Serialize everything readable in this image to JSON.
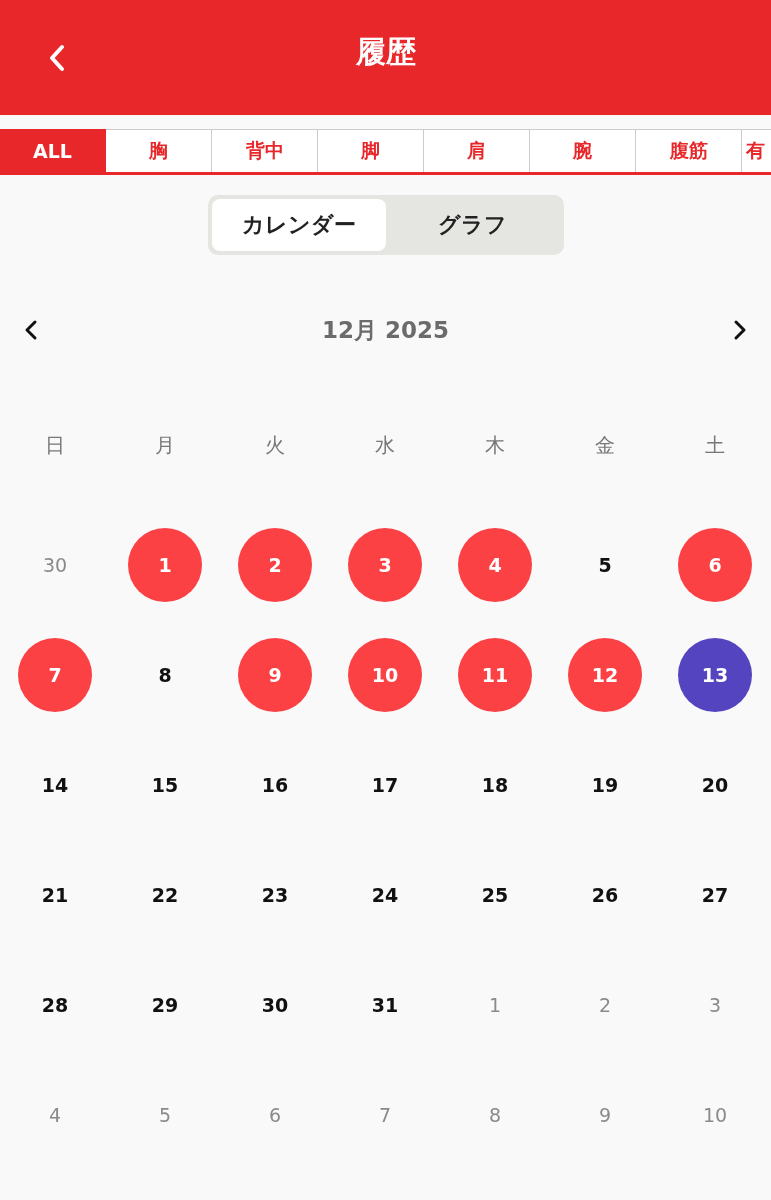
{
  "header": {
    "title": "履歴"
  },
  "tabs": [
    {
      "label": "ALL",
      "selected": true
    },
    {
      "label": "胸",
      "selected": false
    },
    {
      "label": "背中",
      "selected": false
    },
    {
      "label": "脚",
      "selected": false
    },
    {
      "label": "肩",
      "selected": false
    },
    {
      "label": "腕",
      "selected": false
    },
    {
      "label": "腹筋",
      "selected": false
    },
    {
      "label": "有",
      "selected": false
    }
  ],
  "view_switch": [
    {
      "label": "カレンダー",
      "selected": true
    },
    {
      "label": "グラフ",
      "selected": false
    }
  ],
  "calendar": {
    "month": "12月 2025",
    "weekdays": [
      "日",
      "月",
      "火",
      "水",
      "木",
      "金",
      "土"
    ],
    "days": [
      {
        "label": "30",
        "kind": "other"
      },
      {
        "label": "1",
        "kind": "trained"
      },
      {
        "label": "2",
        "kind": "trained"
      },
      {
        "label": "3",
        "kind": "trained"
      },
      {
        "label": "4",
        "kind": "trained"
      },
      {
        "label": "5",
        "kind": "normal"
      },
      {
        "label": "6",
        "kind": "trained"
      },
      {
        "label": "7",
        "kind": "trained"
      },
      {
        "label": "8",
        "kind": "normal"
      },
      {
        "label": "9",
        "kind": "trained"
      },
      {
        "label": "10",
        "kind": "trained"
      },
      {
        "label": "11",
        "kind": "trained"
      },
      {
        "label": "12",
        "kind": "trained"
      },
      {
        "label": "13",
        "kind": "today"
      },
      {
        "label": "14",
        "kind": "normal"
      },
      {
        "label": "15",
        "kind": "normal"
      },
      {
        "label": "16",
        "kind": "normal"
      },
      {
        "label": "17",
        "kind": "normal"
      },
      {
        "label": "18",
        "kind": "normal"
      },
      {
        "label": "19",
        "kind": "normal"
      },
      {
        "label": "20",
        "kind": "normal"
      },
      {
        "label": "21",
        "kind": "normal"
      },
      {
        "label": "22",
        "kind": "normal"
      },
      {
        "label": "23",
        "kind": "normal"
      },
      {
        "label": "24",
        "kind": "normal"
      },
      {
        "label": "25",
        "kind": "normal"
      },
      {
        "label": "26",
        "kind": "normal"
      },
      {
        "label": "27",
        "kind": "normal"
      },
      {
        "label": "28",
        "kind": "normal"
      },
      {
        "label": "29",
        "kind": "normal"
      },
      {
        "label": "30",
        "kind": "normal"
      },
      {
        "label": "31",
        "kind": "normal"
      },
      {
        "label": "1",
        "kind": "other"
      },
      {
        "label": "2",
        "kind": "other"
      },
      {
        "label": "3",
        "kind": "other"
      },
      {
        "label": "4",
        "kind": "other"
      },
      {
        "label": "5",
        "kind": "other"
      },
      {
        "label": "6",
        "kind": "other"
      },
      {
        "label": "7",
        "kind": "other"
      },
      {
        "label": "8",
        "kind": "other"
      },
      {
        "label": "9",
        "kind": "other"
      },
      {
        "label": "10",
        "kind": "other"
      }
    ]
  }
}
